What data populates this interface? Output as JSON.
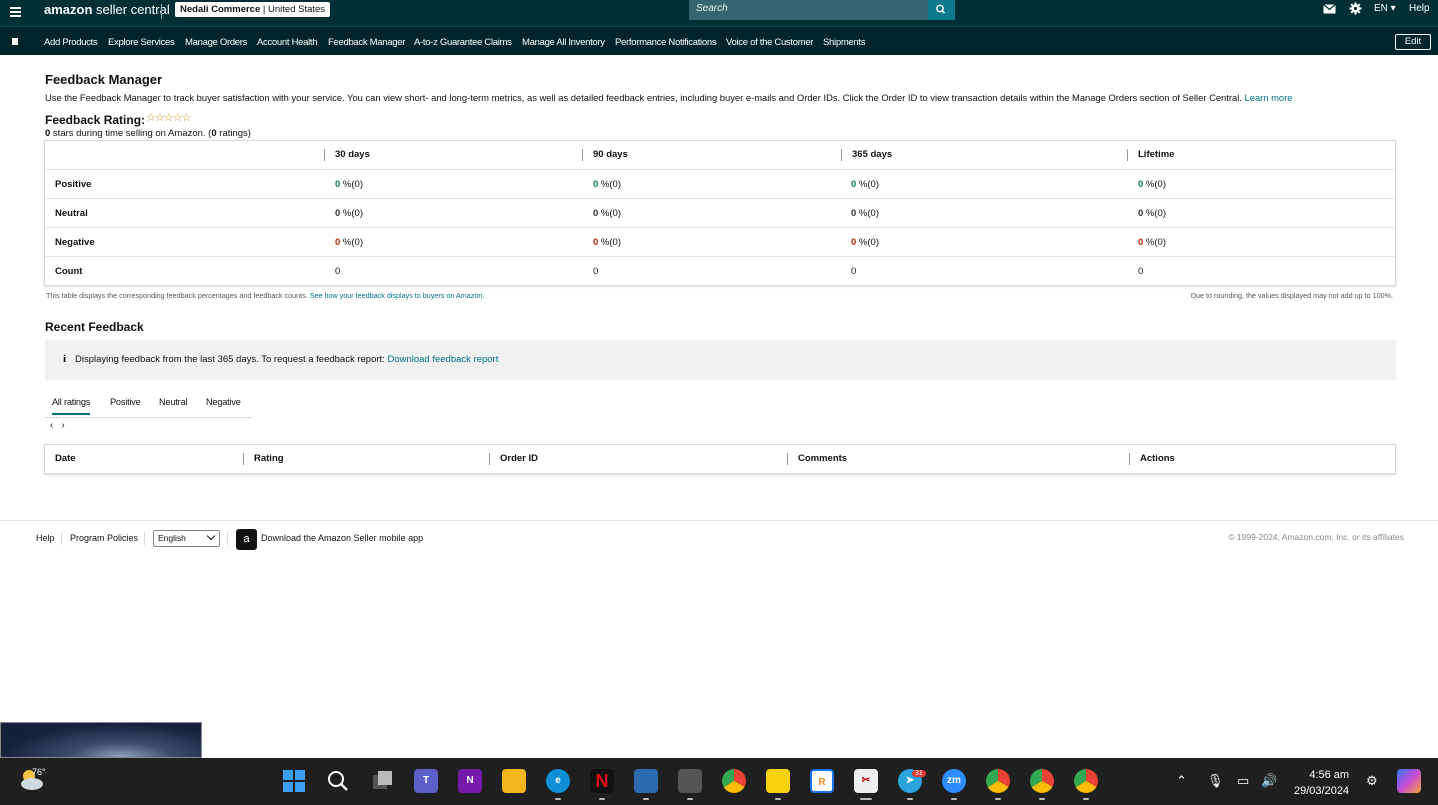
{
  "topbar": {
    "logo_brand": "amazon",
    "logo_rest": " seller central",
    "account_name": "Nedali Commerce",
    "account_region": "United States",
    "search_placeholder": "Search",
    "lang": "EN",
    "help": "Help"
  },
  "nav": {
    "items": [
      "Add Products",
      "Explore Services",
      "Manage Orders",
      "Account Health",
      "Feedback Manager",
      "A-to-z Guarantee Claims",
      "Manage All Inventory",
      "Performance Notifications",
      "Voice of the Customer",
      "Shipments"
    ],
    "edit_label": "Edit"
  },
  "page": {
    "title": "Feedback Manager",
    "description": "Use the Feedback Manager to track buyer satisfaction with your service. You can view short- and long-term metrics, as well as detailed feedback entries, including buyer e-mails and Order IDs. Click the Order ID to view transaction details within the Manage Orders section of Seller Central.",
    "learn_more": "Learn more",
    "rating_label": "Feedback Rating:",
    "stars": "☆☆☆☆☆",
    "rating_value": "0",
    "rating_sub_mid": " stars during time selling on Amazon. (",
    "rating_count": "0",
    "rating_sub_end": " ratings)"
  },
  "feedback_table": {
    "headers": [
      "30 days",
      "90 days",
      "365 days",
      "Lifetime"
    ],
    "rows": [
      {
        "label": "Positive",
        "values": [
          "0",
          "0",
          "0",
          "0"
        ],
        "suffix": " %(0)"
      },
      {
        "label": "Neutral",
        "values": [
          "0",
          "0",
          "0",
          "0"
        ],
        "suffix": " %(0)"
      },
      {
        "label": "Negative",
        "values": [
          "0",
          "0",
          "0",
          "0"
        ],
        "suffix": " %(0)"
      },
      {
        "label": "Count",
        "values": [
          "0",
          "0",
          "0",
          "0"
        ],
        "suffix": ""
      }
    ],
    "note_left": "This table displays the corresponding feedback percentages and feedback counts.",
    "note_left_link": "See how your feedback displays to buyers on Amazon.",
    "note_right": "Due to rounding, the values displayed may not add up to 100%."
  },
  "recent": {
    "title": "Recent Feedback",
    "info_icon": "i",
    "info_text": "Displaying feedback from the last 365 days. To request a feedback report:",
    "info_link": "Download feedback report",
    "tabs": [
      "All ratings",
      "Positive",
      "Neutral",
      "Negative"
    ],
    "pager_prev": "‹",
    "pager_next": "›",
    "columns": [
      "Date",
      "Rating",
      "Order ID",
      "Comments",
      "Actions"
    ]
  },
  "footer": {
    "help": "Help",
    "policies": "Program Policies",
    "language": "English",
    "app_text": "Download the Amazon Seller mobile app",
    "app_icon": "a",
    "copyright": "© 1999-2024, Amazon.com, Inc. or its affiliates"
  },
  "taskbar": {
    "temperature": "76°",
    "time": "4:56 am",
    "date": "29/03/2024",
    "telegram_badge": "31"
  }
}
